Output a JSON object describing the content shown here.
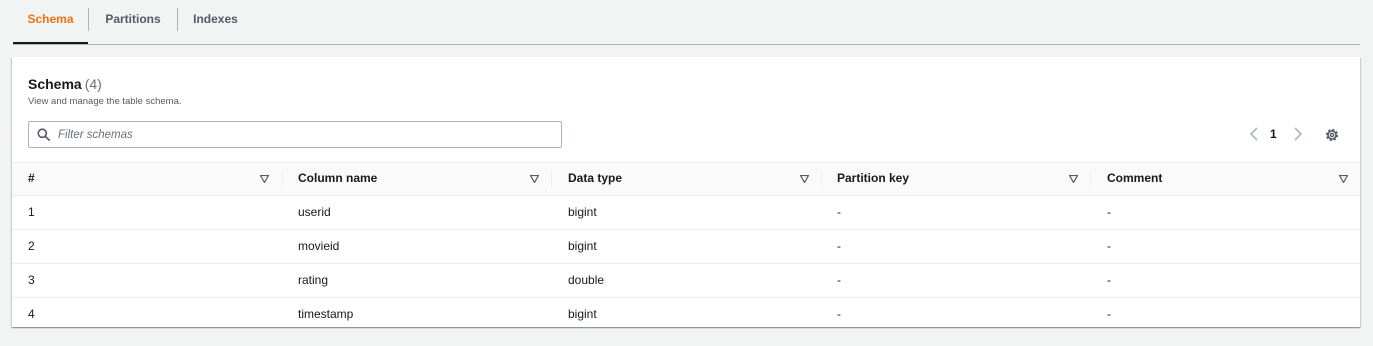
{
  "tabs": [
    {
      "label": "Schema",
      "active": true
    },
    {
      "label": "Partitions",
      "active": false
    },
    {
      "label": "Indexes",
      "active": false
    }
  ],
  "panel": {
    "title": "Schema",
    "count": "(4)",
    "description": "View and manage the table schema."
  },
  "filter": {
    "placeholder": "Filter schemas",
    "value": ""
  },
  "pagination": {
    "current_page": "1"
  },
  "icons": {
    "search": "search-icon",
    "prev": "chevron-left-icon",
    "next": "chevron-right-icon",
    "settings": "gear-icon",
    "sort": "caret-down-icon"
  },
  "colors": {
    "accent": "#ec7211",
    "text": "#16191f",
    "background": "#f2f3f3"
  },
  "table": {
    "columns": [
      "#",
      "Column name",
      "Data type",
      "Partition key",
      "Comment"
    ],
    "rows": [
      [
        "1",
        "userid",
        "bigint",
        "-",
        "-"
      ],
      [
        "2",
        "movieid",
        "bigint",
        "-",
        "-"
      ],
      [
        "3",
        "rating",
        "double",
        "-",
        "-"
      ],
      [
        "4",
        "timestamp",
        "bigint",
        "-",
        "-"
      ]
    ]
  }
}
